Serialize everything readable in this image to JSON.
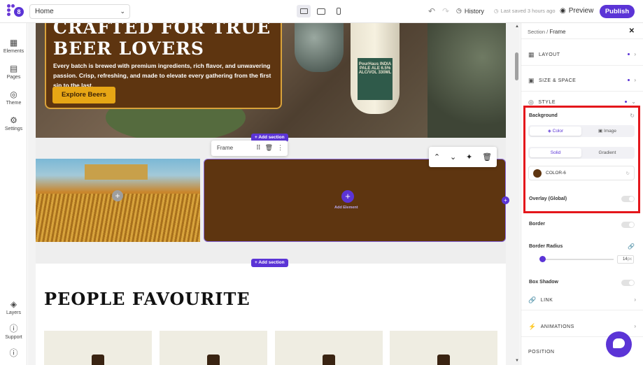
{
  "topbar": {
    "logo_number": "8",
    "page_select": "Home",
    "history_label": "History",
    "saved_label": "Last saved 3 hours ago",
    "preview_label": "Preview",
    "publish_label": "Publish"
  },
  "sidebar": {
    "items": [
      {
        "label": "Elements",
        "icon": "grid-icon"
      },
      {
        "label": "Pages",
        "icon": "page-icon"
      },
      {
        "label": "Theme",
        "icon": "palette-icon"
      },
      {
        "label": "Settings",
        "icon": "gear-icon"
      },
      {
        "label": "Layers",
        "icon": "layers-icon"
      },
      {
        "label": "Support",
        "icon": "help-icon"
      },
      {
        "label": "",
        "icon": "info-icon"
      }
    ]
  },
  "canvas": {
    "hero_heading_line1": "CRAFTED FOR TRUE",
    "hero_heading_line2": "BEER LOVERS",
    "hero_text": "Every batch is brewed with premium ingredients, rich flavor, and unwavering passion. Crisp, refreshing, and made to elevate every gathering from the first sip to the last.",
    "hero_button": "Explore Beers",
    "bottle_label": "PourHaus INDIA PALE ALE 6.5% ALC/VOL 330ML",
    "add_section": "+ Add section",
    "frame_label": "Frame",
    "add_element": "Add Element",
    "people_heading": "PEOPLE FAVOURITE"
  },
  "panel": {
    "breadcrumb_section": "Section",
    "breadcrumb_sep": "/",
    "breadcrumb_frame": "Frame",
    "layout": "LAYOUT",
    "size_space": "SIZE & SPACE",
    "style": "STYLE",
    "background": "Background",
    "tab_color": "Color",
    "tab_image": "Image",
    "tab_solid": "Solid",
    "tab_gradient": "Gradient",
    "color_name": "COLOR-6",
    "overlay": "Overlay (Global)",
    "border": "Border",
    "border_radius": "Border Radius",
    "border_radius_value": "14",
    "border_radius_unit": "px",
    "box_shadow": "Box Shadow",
    "link": "LINK",
    "animations": "ANIMATIONS",
    "position": "POSITION"
  },
  "colors": {
    "accent": "#5b34d6",
    "frame_bg": "#5e3510",
    "hero_button": "#e7a615",
    "highlight": "#e4161b"
  }
}
